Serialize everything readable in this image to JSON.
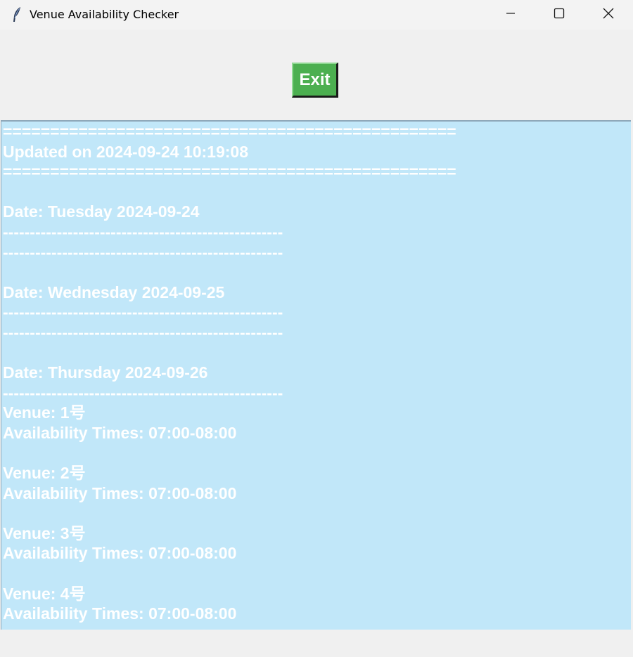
{
  "window": {
    "title": "Venue Availability Checker",
    "icon": "feather-icon",
    "controls": [
      "minimize-icon",
      "maximize-icon",
      "close-icon"
    ]
  },
  "toolbar": {
    "exit_label": "Exit",
    "exit_color": "#4caf50"
  },
  "output": {
    "background": "#c1e7f9",
    "text_color": "#ffffff",
    "lines": [
      "================================================",
      "Updated on 2024-09-24 10:19:08",
      "================================================",
      "",
      "Date: Tuesday 2024-09-24",
      "----------------------------------------------------",
      "----------------------------------------------------",
      "",
      "Date: Wednesday 2024-09-25",
      "----------------------------------------------------",
      "----------------------------------------------------",
      "",
      "Date: Thursday 2024-09-26",
      "----------------------------------------------------",
      "Venue: 1号",
      "Availability Times: 07:00-08:00",
      "",
      "Venue: 2号",
      "Availability Times: 07:00-08:00",
      "",
      "Venue: 3号",
      "Availability Times: 07:00-08:00",
      "",
      "Venue: 4号",
      "Availability Times: 07:00-08:00"
    ]
  }
}
